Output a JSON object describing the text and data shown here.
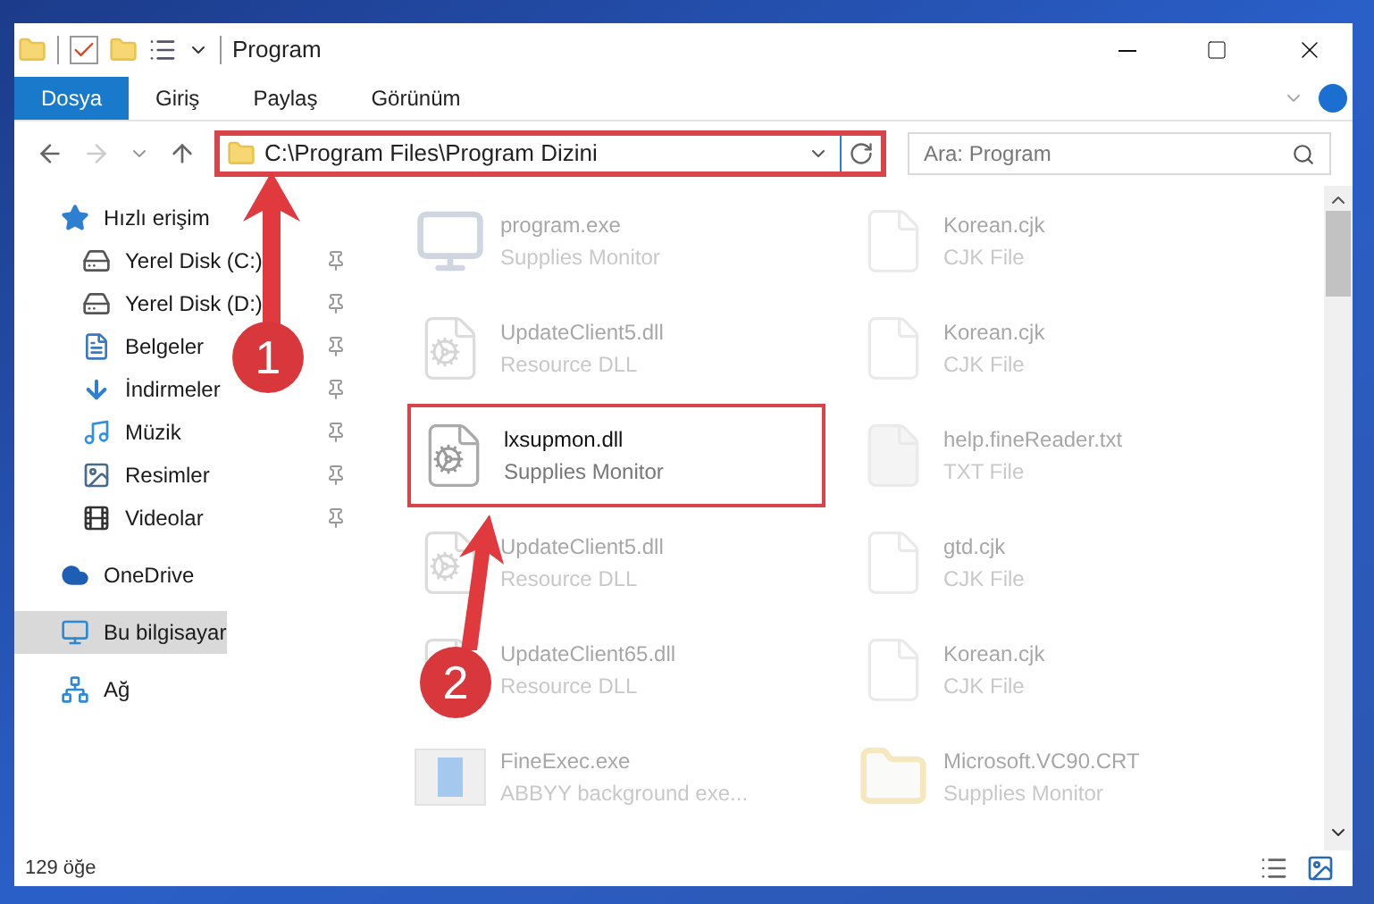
{
  "window": {
    "title": "Program"
  },
  "ribbon_tabs": [
    {
      "label": "Dosya",
      "selected": true
    },
    {
      "label": "Giriş",
      "selected": false
    },
    {
      "label": "Paylaş",
      "selected": false
    },
    {
      "label": "Görünüm",
      "selected": false
    }
  ],
  "address_bar": {
    "path": "C:\\Program Files\\Program Dizini",
    "highlighted": true
  },
  "search": {
    "placeholder": "Ara: Program"
  },
  "sidebar": {
    "items": [
      {
        "kind": "star",
        "label": "Hızlı erişim",
        "selected": false,
        "children": [
          {
            "kind": "drive-c",
            "label": "Yerel Disk (C:)",
            "pinned": true,
            "selected": false
          },
          {
            "kind": "drive",
            "label": "Yerel Disk (D:)",
            "pinned": true,
            "selected": false
          },
          {
            "kind": "documents",
            "label": "Belgeler",
            "pinned": true,
            "selected": false
          },
          {
            "kind": "download",
            "label": "İndirmeler",
            "pinned": true,
            "selected": false
          },
          {
            "kind": "music",
            "label": "Müzik",
            "pinned": true,
            "selected": false
          },
          {
            "kind": "pictures",
            "label": "Resimler",
            "pinned": true,
            "selected": false
          },
          {
            "kind": "videos",
            "label": "Videolar",
            "pinned": true,
            "selected": false
          }
        ]
      },
      {
        "kind": "cloud",
        "label": "OneDrive",
        "selected": false
      },
      {
        "kind": "computer",
        "label": "Bu bilgisayar",
        "selected": true
      },
      {
        "kind": "network",
        "label": "Ağ",
        "selected": false
      }
    ]
  },
  "files": [
    {
      "kind": "exe",
      "name": "program.exe",
      "description": "Supplies Monitor",
      "highlighted": false
    },
    {
      "kind": "cjk",
      "name": "Korean.cjk",
      "description": "CJK File",
      "highlighted": false
    },
    {
      "kind": "dll",
      "name": "UpdateClient5.dll",
      "description": "Resource DLL",
      "highlighted": false
    },
    {
      "kind": "cjk",
      "name": "Korean.cjk",
      "description": "CJK File",
      "highlighted": false
    },
    {
      "kind": "dll",
      "name": "lxsupmon.dll",
      "description": "Supplies Monitor",
      "highlighted": true
    },
    {
      "kind": "txt",
      "name": "help.fineReader.txt",
      "description": "TXT File",
      "highlighted": false
    },
    {
      "kind": "dll",
      "name": "UpdateClient5.dll",
      "description": "Resource DLL",
      "highlighted": false
    },
    {
      "kind": "cjk",
      "name": "gtd.cjk",
      "description": "CJK File",
      "highlighted": false
    },
    {
      "kind": "dll",
      "name": "UpdateClient65.dll",
      "description": "Resource DLL",
      "highlighted": false
    },
    {
      "kind": "cjk",
      "name": "Korean.cjk",
      "description": "CJK File",
      "highlighted": false
    },
    {
      "kind": "app",
      "name": "FineExec.exe",
      "description": "ABBYY background exe...",
      "highlighted": false
    },
    {
      "kind": "folder",
      "name": "Microsoft.VC90.CRT",
      "description": "Supplies Monitor",
      "highlighted": false
    }
  ],
  "status_bar": {
    "item_count": "129 öğe"
  },
  "annotations": [
    {
      "number": "1"
    },
    {
      "number": "2"
    }
  ]
}
